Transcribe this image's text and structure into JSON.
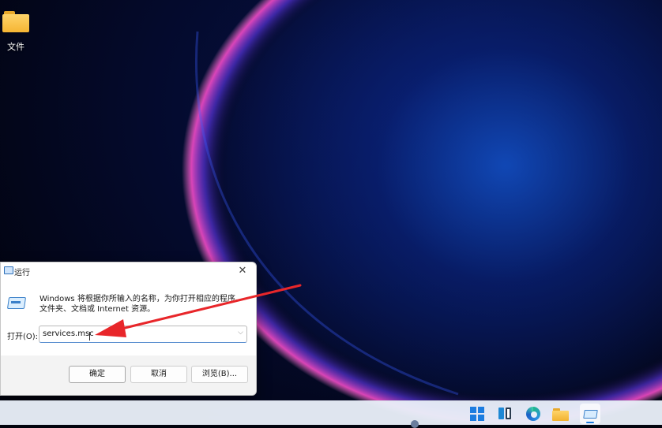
{
  "desktop": {
    "icons": [
      {
        "label": "文件",
        "icon": "folder-icon"
      }
    ]
  },
  "run_dialog": {
    "title": "运行",
    "description": "Windows 将根据你所输入的名称，为你打开相应的程序、文件夹、文档或 Internet 资源。",
    "open_label": "打开(O):",
    "input_value": "services.msc",
    "buttons": {
      "ok": "确定",
      "cancel": "取消",
      "browse": "浏览(B)..."
    },
    "close_symbol": "✕"
  },
  "taskbar": {
    "items": [
      "start-icon",
      "widgets-icon",
      "edge-icon",
      "file-explorer-icon",
      "run-icon"
    ],
    "active": "run-icon"
  },
  "colors": {
    "accent": "#1c7ce0",
    "annotation_arrow": "#e8262a"
  }
}
